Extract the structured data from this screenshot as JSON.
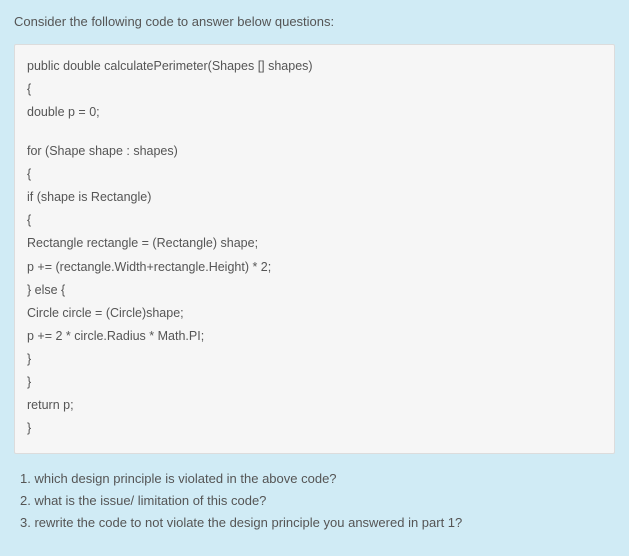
{
  "prompt": "Consider the following code to answer below questions:",
  "code": {
    "stanzas": [
      [
        "public double calculatePerimeter(Shapes [] shapes)",
        "{",
        "double p = 0;"
      ],
      [
        "for (Shape shape : shapes)",
        "{",
        "if (shape is Rectangle)",
        "{",
        "Rectangle rectangle = (Rectangle) shape;",
        "p += (rectangle.Width+rectangle.Height) * 2;",
        "} else {",
        "Circle circle = (Circle)shape;",
        "p += 2 * circle.Radius * Math.PI;",
        "}",
        "}",
        "return p;",
        "}"
      ]
    ]
  },
  "questions": [
    "1. which design principle is violated in the above code?",
    "2. what is the issue/ limitation of this code?",
    "3. rewrite the code to not violate the design principle you answered in part 1?"
  ]
}
